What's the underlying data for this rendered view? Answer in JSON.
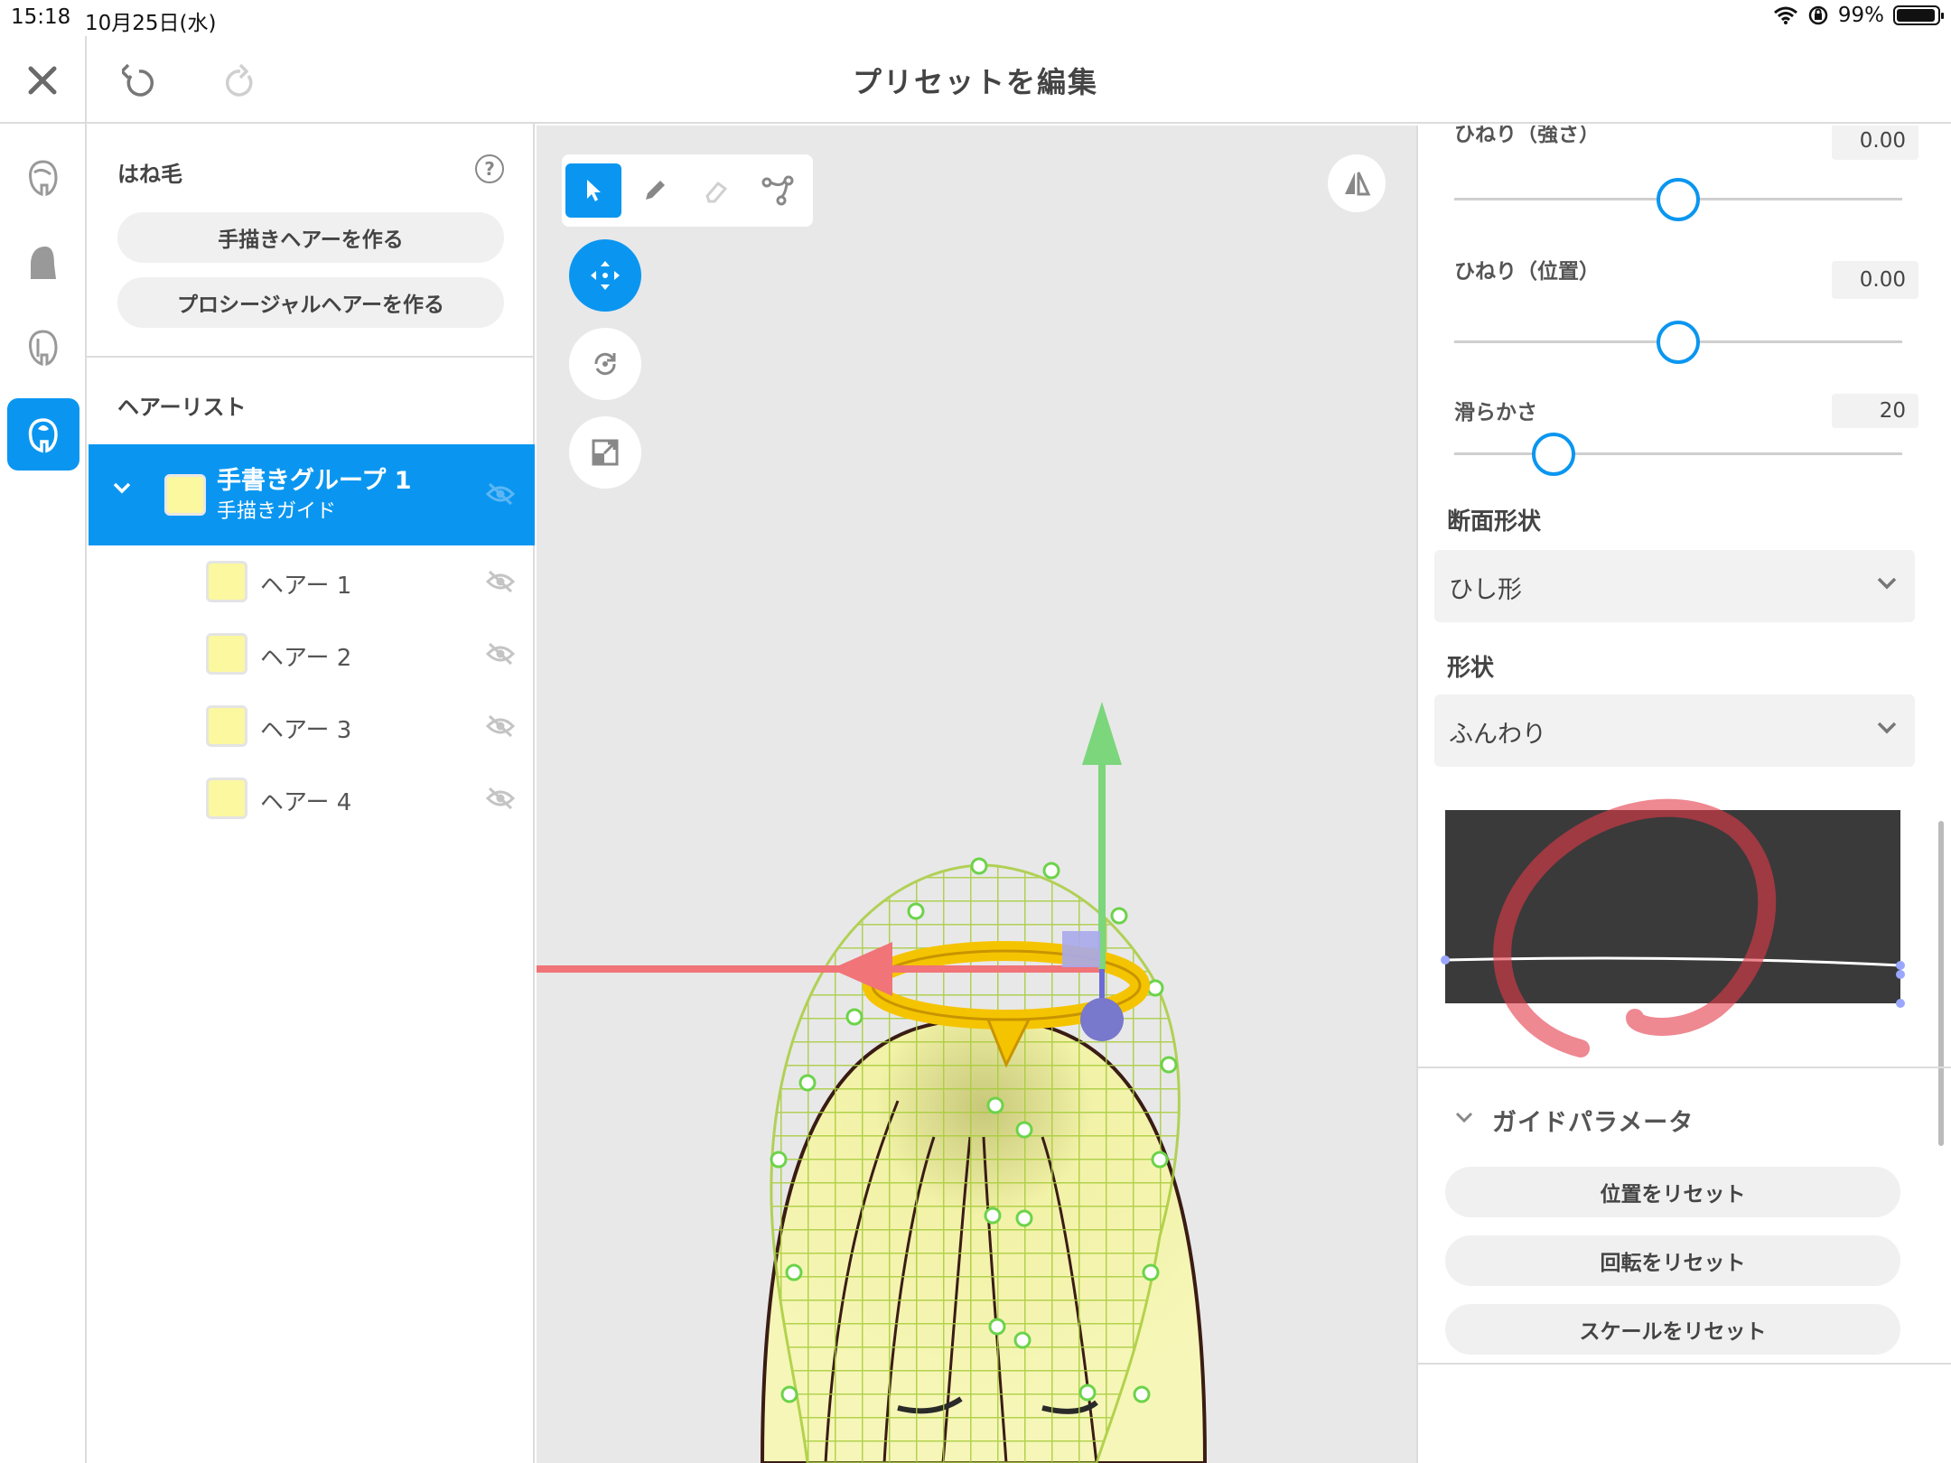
{
  "status_bar": {
    "time": "15:18",
    "date": "10月25日(水)",
    "battery": "99%"
  },
  "header": {
    "title": "プリセットを編集"
  },
  "hair_panel": {
    "category_title": "はね毛",
    "help_glyph": "?",
    "buttons": [
      "手描きヘアーを作る",
      "プロシージャルヘアーを作る"
    ],
    "list_title": "ヘアーリスト",
    "group": {
      "title": "手書きグループ 1",
      "subtitle": "手描きガイド",
      "color": "#fbf8a0"
    },
    "items": [
      {
        "label": "ヘアー 1"
      },
      {
        "label": "ヘアー 2"
      },
      {
        "label": "ヘアー 3"
      },
      {
        "label": "ヘアー 4"
      }
    ]
  },
  "properties": {
    "twist_strength": {
      "label": "ひねり（強さ）",
      "value": "0.00",
      "level": 0.5
    },
    "twist_position": {
      "label": "ひねり（位置）",
      "value": "0.00",
      "level": 0.5
    },
    "smoothness": {
      "label": "滑らかさ",
      "value": "20",
      "level": 0.22
    },
    "cross_section": {
      "label": "断面形状",
      "selected": "ひし形"
    },
    "shape": {
      "label": "形状",
      "selected": "ふんわり"
    },
    "guide": {
      "title": "ガイドパラメータ",
      "buttons": [
        "位置をリセット",
        "回転をリセット",
        "スケールをリセット"
      ]
    }
  },
  "colors": {
    "accent": "#0a96f0",
    "hair": "#fbf8a0",
    "guide_mesh": "#b8d860",
    "halo": "#f5c400"
  }
}
